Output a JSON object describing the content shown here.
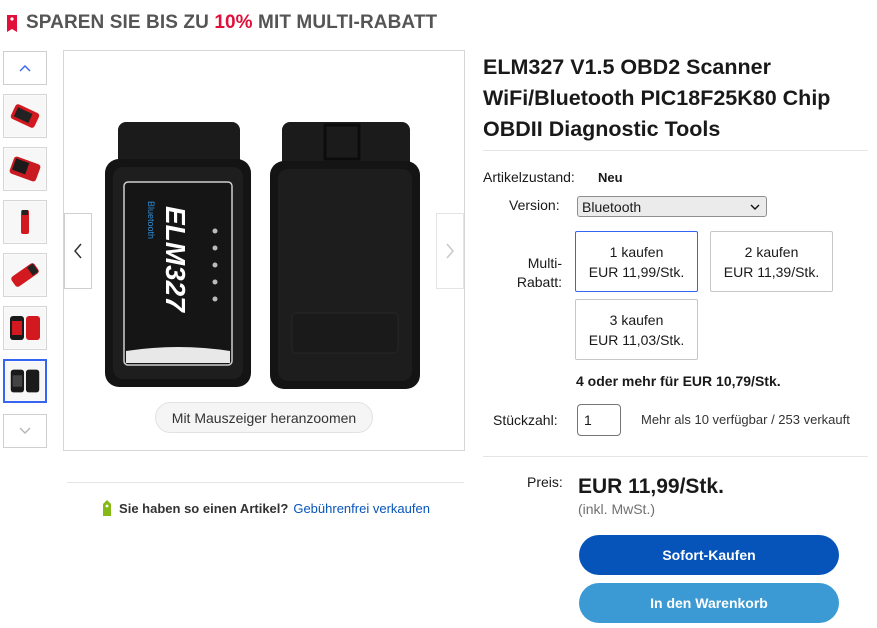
{
  "banner": {
    "prefix": "SPAREN SIE BIS ZU ",
    "percent": "10%",
    "suffix": " MIT MULTI-RABATT",
    "tag_icon": "price-tag-icon",
    "accent": "#e0103a"
  },
  "gallery": {
    "zoom_label": "Mit Mauszeiger heranzoomen",
    "device_brand": "ELM327",
    "thumbnail_count": 6,
    "active_thumbnail": 6
  },
  "sell": {
    "question": "Sie haben so einen Artikel?",
    "link": "Gebührenfrei verkaufen",
    "icon": "tag-icon"
  },
  "product": {
    "title": "ELM327 V1.5 OBD2 Scanner WiFi/Bluetooth PIC18F25K80 Chip OBDII Diagnostic Tools",
    "condition_label": "Artikelzustand:",
    "condition_value": "Neu",
    "version_label": "Version:",
    "version_value": "Bluetooth",
    "multi_label_1": "Multi-",
    "multi_label_2": "Rabatt:",
    "tiers": [
      {
        "qty": "1 kaufen",
        "price": "EUR 11,99/Stk."
      },
      {
        "qty": "2 kaufen",
        "price": "EUR 11,39/Stk."
      },
      {
        "qty": "3 kaufen",
        "price": "EUR 11,03/Stk."
      }
    ],
    "four_or_more": "4 oder mehr für EUR 10,79/Stk.",
    "qty_label": "Stückzahl:",
    "qty_value": "1",
    "availability": "Mehr als 10 verfügbar / 253 verkauft",
    "price_label": "Preis:",
    "price_value": "EUR 11,99/Stk.",
    "vat": "(inkl. MwSt.)",
    "buy_now": "Sofort-Kaufen",
    "add_to_cart": "In den Warenkorb"
  },
  "colors": {
    "primary_button": "#0654ba",
    "secondary_button": "#3b9ad4",
    "selected_border": "#3665f3"
  }
}
